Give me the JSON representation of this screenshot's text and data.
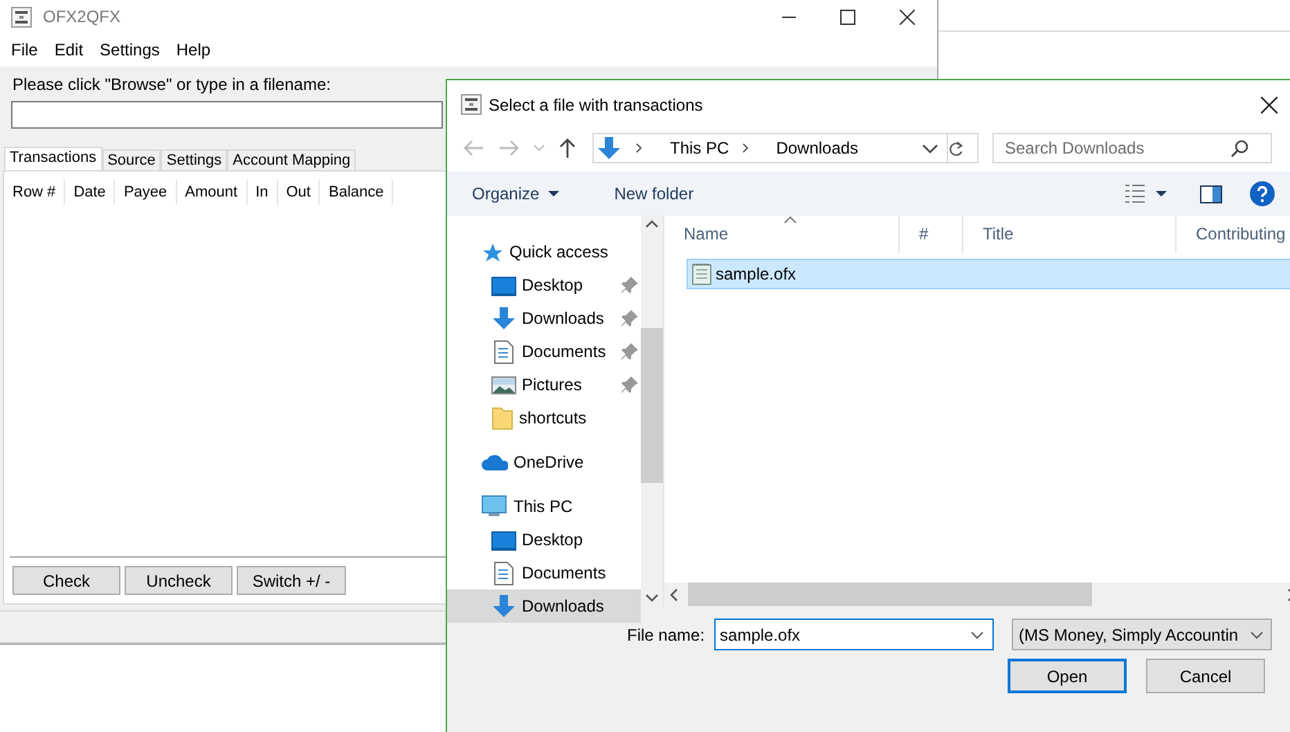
{
  "main_window": {
    "title": "OFX2QFX",
    "menu": [
      "File",
      "Edit",
      "Settings",
      "Help"
    ],
    "prompt": "Please click \"Browse\" or type in a filename:",
    "tabs": [
      {
        "label": "Transactions",
        "selected": true
      },
      {
        "label": "Source",
        "selected": false
      },
      {
        "label": "Settings",
        "selected": false
      },
      {
        "label": "Account Mapping",
        "selected": false
      }
    ],
    "columns": [
      "Row #",
      "Date",
      "Payee",
      "Amount",
      "In",
      "Out",
      "Balance"
    ],
    "buttons": [
      "Check",
      "Uncheck",
      "Switch +/ -"
    ]
  },
  "dialog": {
    "title": "Select a file with transactions",
    "breadcrumb": [
      "This PC",
      "Downloads"
    ],
    "search": {
      "placeholder": "Search Downloads"
    },
    "toolbar": {
      "organize": "Organize",
      "new_folder": "New folder"
    },
    "nav": [
      {
        "label": "Quick access",
        "kind": "star",
        "selected": false,
        "children": [
          {
            "label": "Desktop",
            "kind": "desktop",
            "pinned": true,
            "selected": false
          },
          {
            "label": "Downloads",
            "kind": "download",
            "pinned": true,
            "selected": false
          },
          {
            "label": "Documents",
            "kind": "document",
            "pinned": true,
            "selected": false
          },
          {
            "label": "Pictures",
            "kind": "pictures",
            "pinned": true,
            "selected": false
          },
          {
            "label": "shortcuts",
            "kind": "folder",
            "pinned": false,
            "selected": false
          }
        ]
      },
      {
        "label": "OneDrive",
        "kind": "cloud",
        "selected": false
      },
      {
        "label": "This PC",
        "kind": "pc",
        "selected": false,
        "children": [
          {
            "label": "Desktop",
            "kind": "desktop",
            "pinned": false,
            "selected": false
          },
          {
            "label": "Documents",
            "kind": "document",
            "pinned": false,
            "selected": false
          },
          {
            "label": "Downloads",
            "kind": "download",
            "pinned": false,
            "selected": true
          }
        ]
      }
    ],
    "columns": [
      "Name",
      "#",
      "Title",
      "Contributing"
    ],
    "files": [
      {
        "name": "sample.ofx",
        "selected": true
      }
    ],
    "file_name_label": "File name:",
    "file_name": "sample.ofx",
    "file_type": "(MS Money, Simply Accountin",
    "buttons": [
      {
        "label": "Open",
        "default": true
      },
      {
        "label": "Cancel",
        "default": false
      }
    ]
  }
}
